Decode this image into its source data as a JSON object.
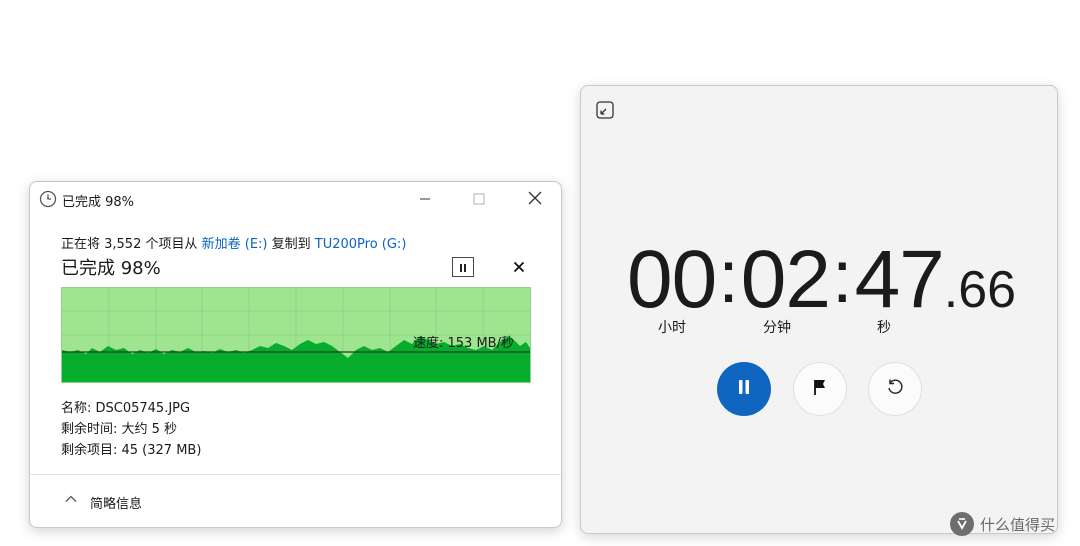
{
  "copy_dialog": {
    "title": "已完成 98%",
    "desc_prefix": "正在将 3,552 个项目从 ",
    "source": "新加卷 (E:)",
    "desc_middle": " 复制到 ",
    "destination": "TU200Pro (G:)",
    "progress_title": "已完成 98%",
    "progress": 0.98,
    "speed": "速度: 153 MB/秒",
    "name_line": "名称: DSC05745.JPG",
    "time_left_line": "剩余时间: 大约 5 秒",
    "items_left_line": "剩余项目: 45 (327 MB)",
    "footer_label": "简略信息",
    "colors": {
      "graph_bg": "#9fe48f",
      "graph_fill": "#06ac2c",
      "link": "#0b63c4"
    },
    "icons": [
      "clock-icon",
      "minimize-icon",
      "maximize-icon",
      "close-icon",
      "pause-icon",
      "cancel-icon",
      "chevron-up-icon"
    ]
  },
  "stopwatch": {
    "hours": "00",
    "minutes": "02",
    "seconds": "47",
    "fraction": ".66",
    "labels": {
      "hours": "小时",
      "minutes": "分钟",
      "seconds": "秒"
    },
    "colors": {
      "accent": "#0f66c0"
    },
    "icons": [
      "compact-overlay-icon",
      "pause-icon",
      "flag-icon",
      "reset-icon"
    ]
  },
  "watermark": {
    "logo_char": "值",
    "text": "什么值得买"
  }
}
